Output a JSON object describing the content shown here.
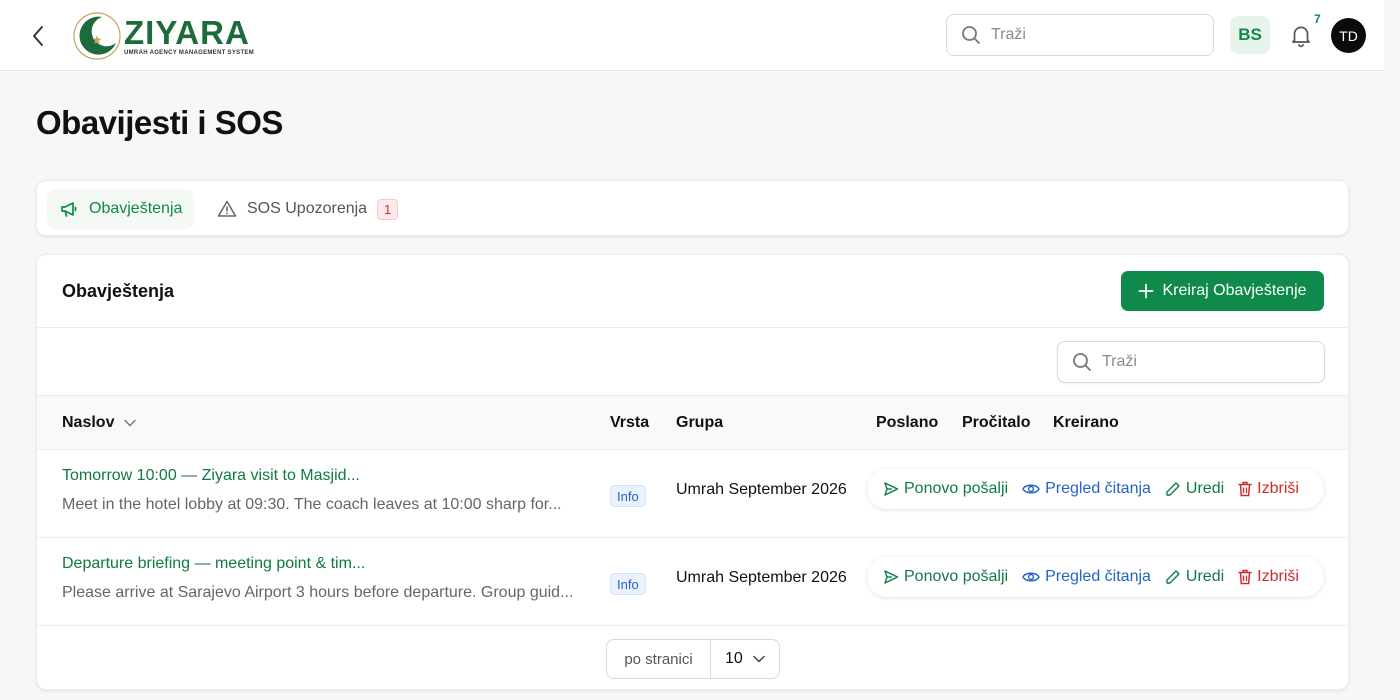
{
  "header": {
    "logo_name": "ZIYARA",
    "logo_subtitle": "UMRAH AGENCY MANAGEMENT SYSTEM",
    "search_placeholder": "Traži",
    "language": "BS",
    "notification_count": "7",
    "avatar_initials": "TD"
  },
  "page": {
    "title": "Obavijesti i SOS"
  },
  "tabs": [
    {
      "label": "Obavještenja",
      "icon": "megaphone-icon",
      "active": true
    },
    {
      "label": "SOS Upozorenja",
      "icon": "warning-icon",
      "badge": "1"
    }
  ],
  "card": {
    "title": "Obavještenja",
    "create_label": "Kreiraj Obavještenje",
    "search_placeholder": "Traži"
  },
  "table": {
    "columns": [
      "Naslov",
      "Vrsta",
      "Grupa",
      "Poslano",
      "Pročitalo",
      "Kreirano"
    ],
    "rows": [
      {
        "title": "Tomorrow 10:00 — Ziyara visit to Masjid...",
        "description": "Meet in the hotel lobby at 09:30. The coach leaves at 10:00 sharp for...",
        "type": "Info",
        "group": "Umrah September 2026"
      },
      {
        "title": "Departure briefing — meeting point & tim...",
        "description": "Please arrive at Sarajevo Airport 3 hours before departure. Group guid...",
        "type": "Info",
        "group": "Umrah September 2026"
      }
    ],
    "actions": {
      "resend": "Ponovo pošalji",
      "review": "Pregled čitanja",
      "edit": "Uredi",
      "delete": "Izbriši"
    }
  },
  "pagination": {
    "label": "po stranici",
    "per_page": "10"
  },
  "colors": {
    "brand_green": "#0f8a4a",
    "link_blue": "#2463c7",
    "danger_red": "#d02a2a"
  }
}
